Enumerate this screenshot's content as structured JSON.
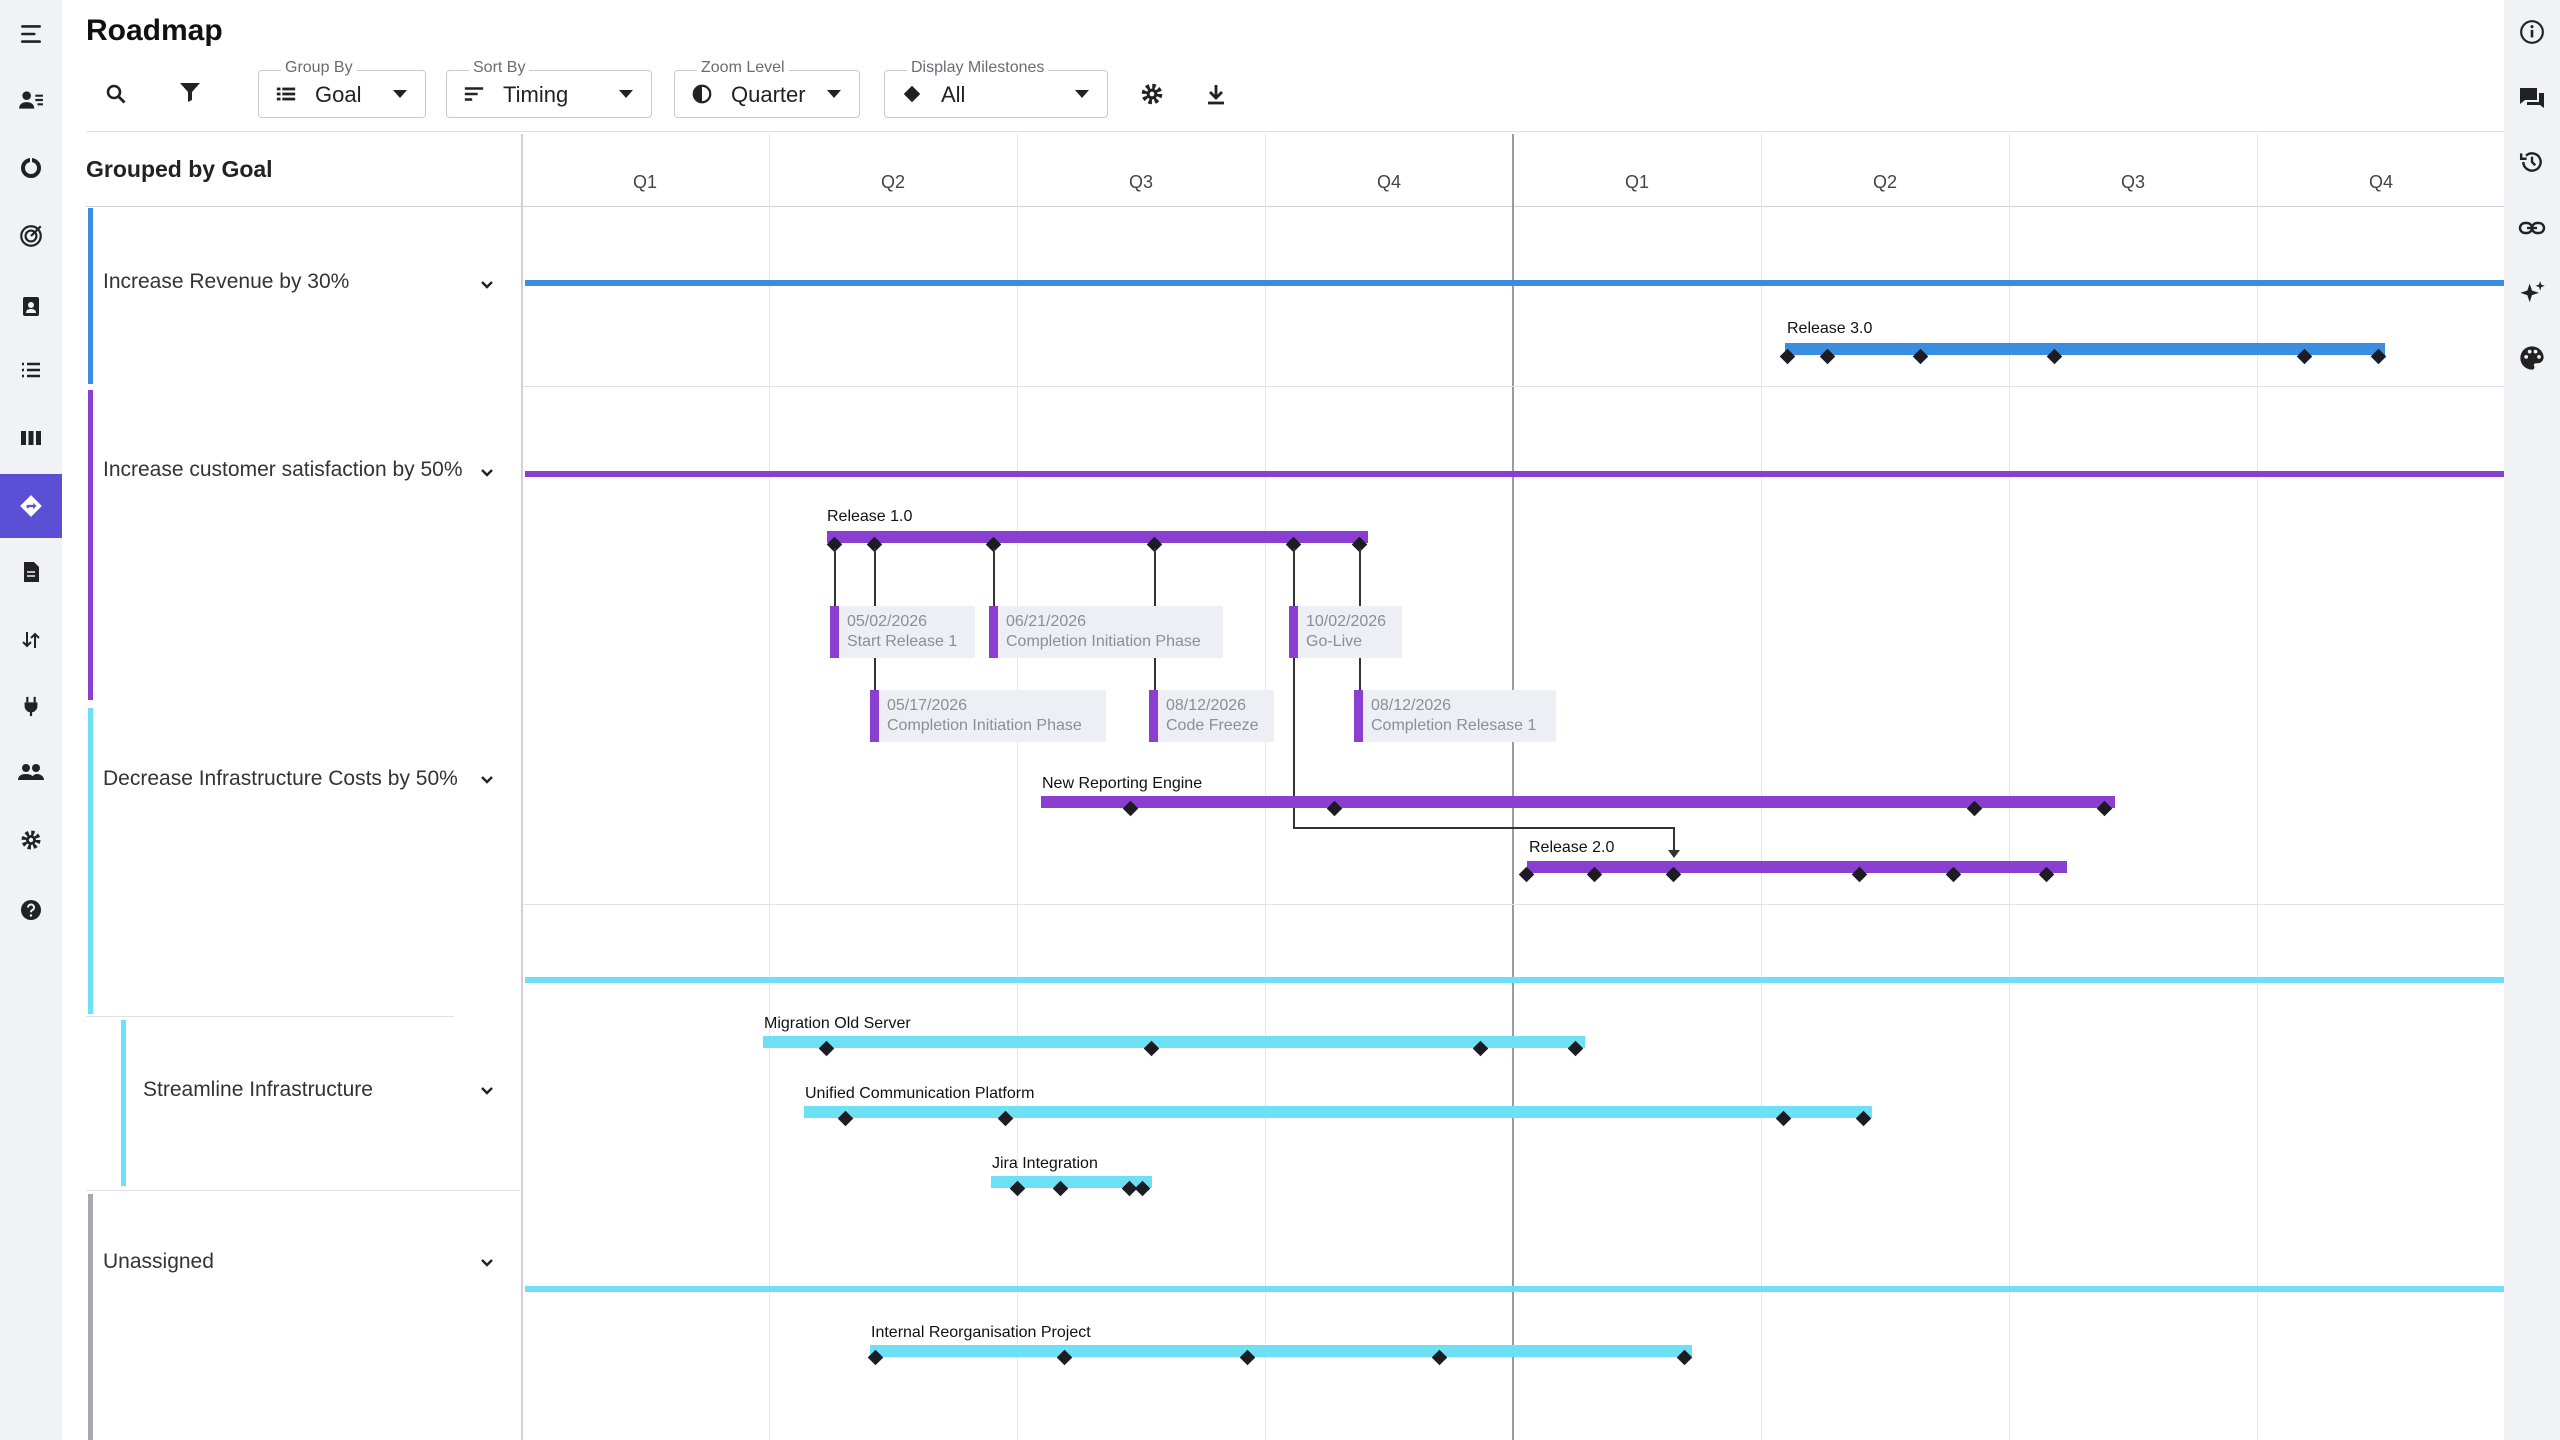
{
  "app": {
    "title": "Roadmap"
  },
  "toolbar": {
    "group_by": {
      "label": "Group By",
      "value": "Goal"
    },
    "sort_by": {
      "label": "Sort By",
      "value": "Timing"
    },
    "zoom_level": {
      "label": "Zoom Level",
      "value": "Quarter"
    },
    "display_milestones": {
      "label": "Display Milestones",
      "value": "All"
    }
  },
  "grouped_title": "Grouped by Goal",
  "quarters": [
    "Q1",
    "Q2",
    "Q3",
    "Q4",
    "Q1",
    "Q2",
    "Q3",
    "Q4"
  ],
  "groups": {
    "revenue": {
      "label": "Increase Revenue by 30%",
      "color": "#3b8de0"
    },
    "satisfaction": {
      "label": "Increase customer satisfaction by 50%",
      "color": "#8a3fd0"
    },
    "infra_costs": {
      "label": "Decrease Infrastructure Costs by 50%",
      "color": "#6ee0f5"
    },
    "streamline": {
      "label": "Streamline Infrastructure",
      "color": "#6ee0f5"
    },
    "unassigned": {
      "label": "Unassigned",
      "color": "#a8a8ae"
    }
  },
  "bars": {
    "release3": "Release 3.0",
    "release1": "Release 1.0",
    "reporting": "New Reporting Engine",
    "release2": "Release 2.0",
    "migration": "Migration Old Server",
    "unified": "Unified Communication Platform",
    "jira": "Jira Integration",
    "reorg": "Internal Reorganisation Project"
  },
  "milestone_callouts": [
    {
      "date": "05/02/2026",
      "name": "Start Release 1"
    },
    {
      "date": "05/17/2026",
      "name": "Completion Initiation Phase"
    },
    {
      "date": "06/21/2026",
      "name": "Completion Initiation Phase"
    },
    {
      "date": "08/12/2026",
      "name": "Code Freeze"
    },
    {
      "date": "10/02/2026",
      "name": "Go-Live"
    },
    {
      "date": "08/12/2026",
      "name": "Completion Relesase 1"
    }
  ],
  "colors": {
    "accent": "#5b4fd6",
    "blue": "#3b8de0",
    "purple": "#8a3fd0",
    "cyan": "#6ee0f5"
  },
  "icons": {
    "left_nav": [
      "menu-icon",
      "user-list-icon",
      "chart-icon",
      "target-icon",
      "clipboard-user-icon",
      "list-icon",
      "columns-icon",
      "roadmap-icon",
      "document-icon",
      "sort-icon",
      "plug-icon",
      "team-icon",
      "gear-icon",
      "help-icon"
    ],
    "right_nav": [
      "info-icon",
      "chat-icon",
      "history-icon",
      "link-icon",
      "sparkle-icon",
      "palette-icon"
    ]
  }
}
